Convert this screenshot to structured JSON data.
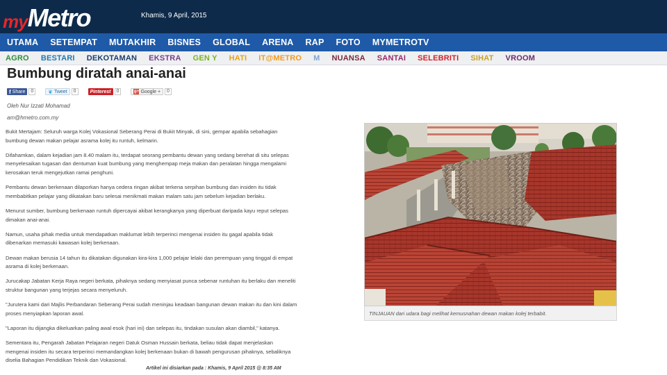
{
  "header": {
    "logo_my": "my",
    "logo_metro": "Metro",
    "date": "Khamis, 9 April, 2015"
  },
  "main_nav": [
    {
      "label": "UTAMA"
    },
    {
      "label": "SETEMPAT"
    },
    {
      "label": "MUTAKHIR"
    },
    {
      "label": "BISNES"
    },
    {
      "label": "GLOBAL"
    },
    {
      "label": "ARENA"
    },
    {
      "label": "RAP"
    },
    {
      "label": "FOTO"
    },
    {
      "label": "MYMETROTV"
    }
  ],
  "sub_nav": [
    {
      "label": "AGRO",
      "color": "#2e8b3a"
    },
    {
      "label": "BESTARI",
      "color": "#1f78b4"
    },
    {
      "label": "DEKOTAMAN",
      "color": "#1b3e6f"
    },
    {
      "label": "EKSTRA",
      "color": "#7a3d8c"
    },
    {
      "label": "GEN Y",
      "color": "#79b41d"
    },
    {
      "label": "HATI",
      "color": "#e8a21c"
    },
    {
      "label": "IT@METRO",
      "color": "#f29a1c"
    },
    {
      "label": "M",
      "color": "#7aa7d6"
    },
    {
      "label": "NUANSA",
      "color": "#7b2a3a"
    },
    {
      "label": "SANTAI",
      "color": "#9a2a6a"
    },
    {
      "label": "SELEBRITI",
      "color": "#d2232a"
    },
    {
      "label": "SIHAT",
      "color": "#c9a227"
    },
    {
      "label": "VROOM",
      "color": "#6e2a6e"
    }
  ],
  "article": {
    "title": "Bumbung diratah anai-anai",
    "share": {
      "facebook_label": "Share",
      "facebook_count": "0",
      "twitter_label": "Tweet",
      "twitter_count": "0",
      "pinterest_label": "Pinterest",
      "pinterest_count": "0",
      "google_label": "Google +",
      "google_count": "0"
    },
    "author": "Oleh Nur Izzati Mohamad",
    "email": "am@hmetro.com.my",
    "paragraphs": [
      "Bukit Mertajam: Seluruh warga Kolej Vokasional Seberang Perai di Bukit Minyak, di sini, gempar apabila sebahagian bumbung dewan makan pelajar asrama kolej itu runtuh, kelmarin.",
      "Difahamkan, dalam kejadian jam 8.40 malam itu, terdapat seorang pembantu dewan yang sedang berehat di situ selepas menyelesaikan tugasan dan dentuman kuat bumbung yang menghempap meja makan dan peralatan hingga mengalami kerosakan teruk mengejutkan ramai penghuni.",
      "Pembantu dewan berkenaan dilaporkan hanya cedera ringan akibat terkena serpihan bumbung dan insiden itu tidak membabitkan pelajar yang dikatakan baru selesai menikmati makan malam satu jam sebelum kejadian berlaku.",
      "Menurut sumber, bumbung berkenaan runtuh dipercayai akibat kerangkanya yang diperbuat daripada kayu reput selepas dimakan anai-anai.",
      "Namun, usaha pihak media untuk mendapatkan maklumat lebih terperinci mengenai insiden itu gagal apabila tidak dibenarkan memasuki kawasan kolej berkenaan.",
      "Dewan makan berusia 14 tahun itu dikatakan digunakan kira-kira 1,000 pelajar lelaki dan perempuan yang tinggal di empat asrama di kolej berkenaan.",
      "Jurucakap Jabatan Kerja Raya negeri berkata, pihaknya sedang menyiasat punca sebenar runtuhan itu berlaku dan meneliti struktur bangunan yang terjejas secara menyeluruh.",
      "\"Jurutera kami dari Majlis Perbandaran Seberang Perai sudah meninjau keadaan bangunan dewan makan itu dan kini dalam proses menyiapkan laporan awal.",
      "\"Laporan itu dijangka dikeluarkan paling awal esok (hari ini) dan selepas itu, tindakan susulan akan diambil,\" katanya.",
      "Sementara itu, Pengarah Jabatan Pelajaran negeri Datuk Osman Hussain berkata, beliau tidak dapat menjelaskan mengenai insiden itu secara terperinci memandangkan kolej berkenaan bukan di bawah pengurusan pihaknya, sebaliknya diselia Bahagian Pendidikan Teknik dan Vokasional."
    ],
    "footer": "Artikel ini disiarkan pada : Khamis, 9 April 2015 @ 8:35 AM",
    "caption": "TINJAUAN dari udara bagi melihat kemusnahan dewan makan kolej terbabit."
  }
}
